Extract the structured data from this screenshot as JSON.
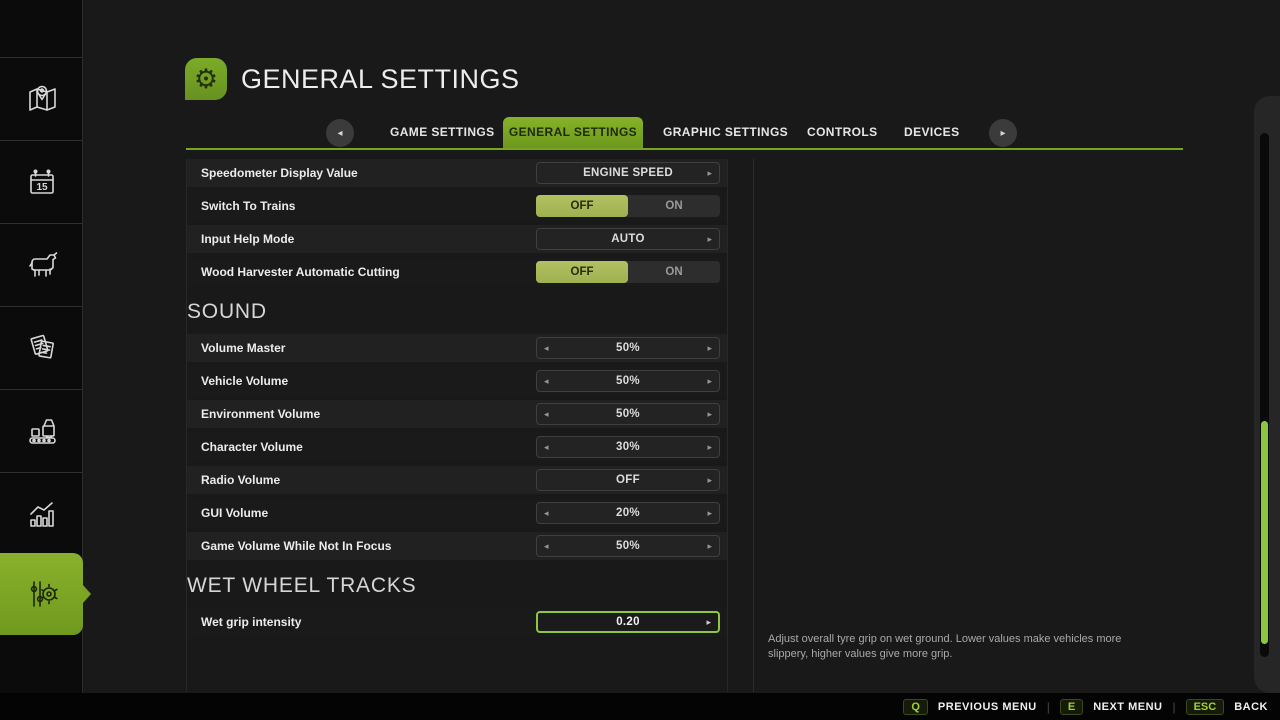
{
  "header": {
    "title": "GENERAL SETTINGS",
    "icon": "gear"
  },
  "tabs": {
    "prev_arrow": "◂",
    "next_arrow": "▸",
    "items": [
      {
        "label": "GAME SETTINGS",
        "active": false
      },
      {
        "label": "GENERAL SETTINGS",
        "active": true
      },
      {
        "label": "GRAPHIC SETTINGS",
        "active": false
      },
      {
        "label": "CONTROLS",
        "active": false
      },
      {
        "label": "DEVICES",
        "active": false
      }
    ]
  },
  "sidebar": {
    "calendar_day": "15",
    "items": [
      {
        "name": "map",
        "active": false
      },
      {
        "name": "calendar",
        "active": false
      },
      {
        "name": "animals",
        "active": false
      },
      {
        "name": "contracts",
        "active": false
      },
      {
        "name": "production",
        "active": false
      },
      {
        "name": "statistics",
        "active": false
      },
      {
        "name": "settings",
        "active": true
      }
    ]
  },
  "settings": {
    "sections": [
      {
        "title": "",
        "rows": [
          {
            "label": "Speedometer Display Value",
            "control": {
              "type": "select",
              "value": "ENGINE SPEED",
              "arrows": [
                "right"
              ]
            }
          },
          {
            "label": "Switch To Trains",
            "control": {
              "type": "toggle",
              "options": [
                "OFF",
                "ON"
              ],
              "selected": "OFF"
            }
          },
          {
            "label": "Input Help Mode",
            "control": {
              "type": "select",
              "value": "AUTO",
              "arrows": [
                "right"
              ]
            }
          },
          {
            "label": "Wood Harvester Automatic Cutting",
            "control": {
              "type": "toggle",
              "options": [
                "OFF",
                "ON"
              ],
              "selected": "OFF"
            }
          }
        ]
      },
      {
        "title": "SOUND",
        "rows": [
          {
            "label": "Volume Master",
            "control": {
              "type": "stepper",
              "value": "50%",
              "arrows": [
                "left",
                "right"
              ]
            }
          },
          {
            "label": "Vehicle Volume",
            "control": {
              "type": "stepper",
              "value": "50%",
              "arrows": [
                "left",
                "right"
              ]
            }
          },
          {
            "label": "Environment Volume",
            "control": {
              "type": "stepper",
              "value": "50%",
              "arrows": [
                "left",
                "right"
              ]
            }
          },
          {
            "label": "Character Volume",
            "control": {
              "type": "stepper",
              "value": "30%",
              "arrows": [
                "left",
                "right"
              ]
            }
          },
          {
            "label": "Radio Volume",
            "control": {
              "type": "stepper",
              "value": "OFF",
              "arrows": [
                "right"
              ]
            }
          },
          {
            "label": "GUI Volume",
            "control": {
              "type": "stepper",
              "value": "20%",
              "arrows": [
                "left",
                "right"
              ]
            }
          },
          {
            "label": "Game Volume While Not In Focus",
            "control": {
              "type": "stepper",
              "value": "50%",
              "arrows": [
                "left",
                "right"
              ]
            }
          }
        ]
      },
      {
        "title": "WET WHEEL TRACKS",
        "rows": [
          {
            "label": "Wet grip intensity",
            "control": {
              "type": "stepper",
              "value": "0.20",
              "arrows": [
                "right"
              ],
              "focused": true
            }
          }
        ]
      }
    ]
  },
  "help": {
    "text": "Adjust overall tyre grip on wet ground. Lower values make vehicles more slippery, higher values give more grip."
  },
  "footer": {
    "items": [
      {
        "key": "Q",
        "label": "PREVIOUS MENU"
      },
      {
        "key": "E",
        "label": "NEXT MENU"
      },
      {
        "key": "ESC",
        "label": "BACK"
      }
    ]
  },
  "colors": {
    "accent": "#8dc63f",
    "tab_green": "#76a01e",
    "toggle_green": "#a9ba5a",
    "underline": "#79a420"
  }
}
